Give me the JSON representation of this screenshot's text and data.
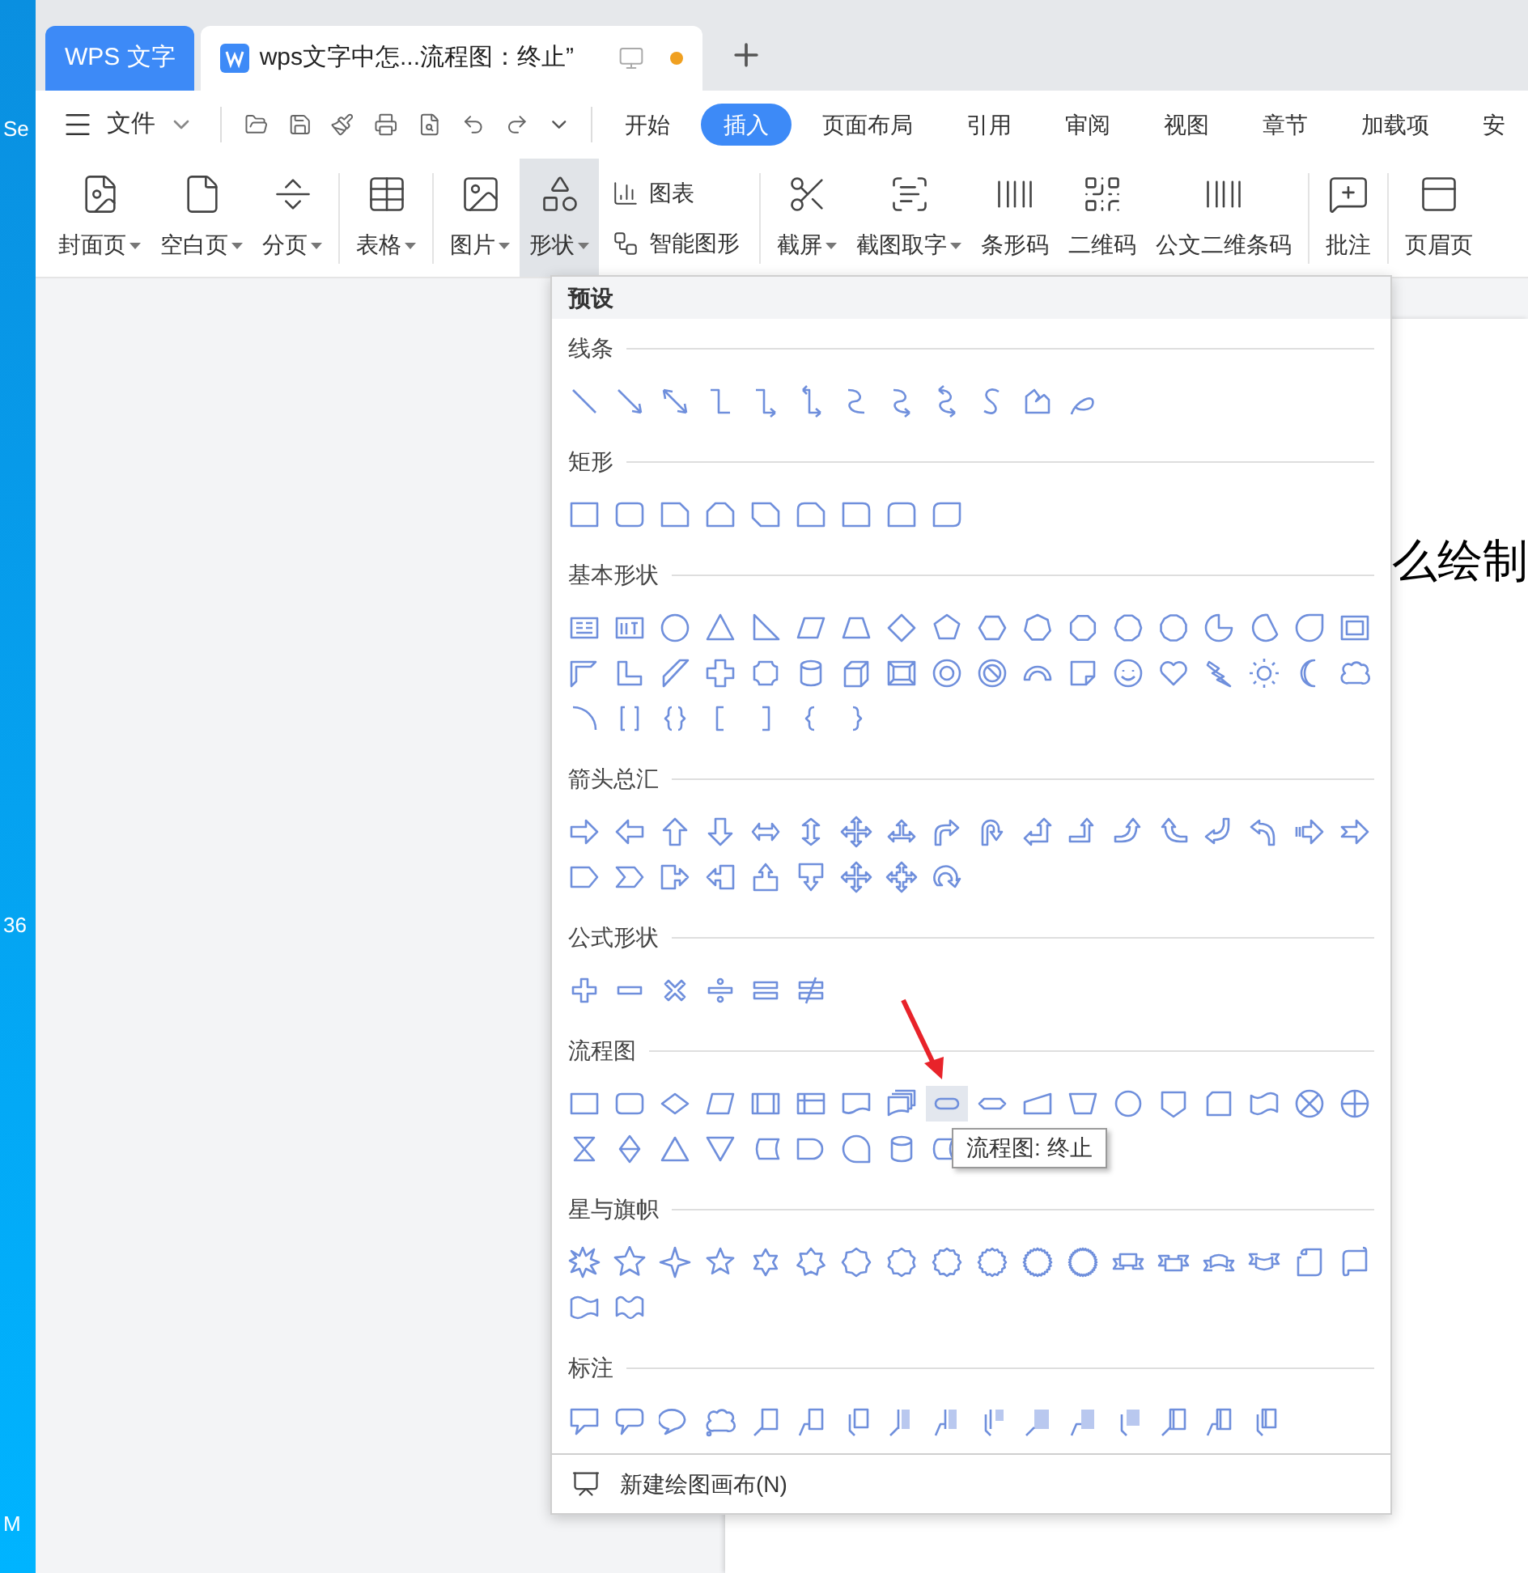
{
  "desktop": {
    "icons": [
      {
        "label": "Se"
      },
      {
        "label": "36"
      },
      {
        "label": "M"
      }
    ]
  },
  "tabs": [
    {
      "label": "WPS 文字",
      "kind": "app",
      "selected": false,
      "modified": false
    },
    {
      "label": "wps文字中怎...流程图：终止”",
      "kind": "document",
      "selected": true,
      "modified": true
    }
  ],
  "menu": {
    "label": "文件"
  },
  "ribbon_tabs": [
    {
      "label": "开始",
      "selected": false
    },
    {
      "label": "插入",
      "selected": true
    },
    {
      "label": "页面布局",
      "selected": false
    },
    {
      "label": "引用",
      "selected": false
    },
    {
      "label": "审阅",
      "selected": false
    },
    {
      "label": "视图",
      "selected": false
    },
    {
      "label": "章节",
      "selected": false
    },
    {
      "label": "加载项",
      "selected": false
    },
    {
      "label": "安",
      "selected": false
    }
  ],
  "ribbon": {
    "groups": [
      {
        "items": [
          {
            "label": "封面页",
            "kind": "large",
            "dropdown": true,
            "selected": false
          },
          {
            "label": "空白页",
            "kind": "large",
            "dropdown": true,
            "selected": false
          },
          {
            "label": "分页",
            "kind": "large",
            "dropdown": true,
            "selected": false
          }
        ]
      },
      {
        "items": [
          {
            "label": "表格",
            "kind": "large",
            "dropdown": true,
            "selected": false
          }
        ]
      },
      {
        "items": [
          {
            "label": "图片",
            "kind": "large",
            "dropdown": true,
            "selected": false
          },
          {
            "label": "形状",
            "kind": "large",
            "dropdown": true,
            "selected": true
          },
          {
            "label": "图表",
            "kind": "small",
            "dropdown": false,
            "selected": false
          },
          {
            "label": "智能图形",
            "kind": "small",
            "dropdown": false,
            "selected": false
          }
        ]
      },
      {
        "items": [
          {
            "label": "截屏",
            "kind": "large",
            "dropdown": true,
            "selected": false
          },
          {
            "label": "截图取字",
            "kind": "large",
            "dropdown": true,
            "selected": false
          },
          {
            "label": "条形码",
            "kind": "large",
            "dropdown": false,
            "selected": false
          },
          {
            "label": "二维码",
            "kind": "large",
            "dropdown": false,
            "selected": false
          },
          {
            "label": "公文二维条码",
            "kind": "large",
            "dropdown": false,
            "selected": false
          }
        ]
      },
      {
        "items": [
          {
            "label": "批注",
            "kind": "large",
            "dropdown": false,
            "selected": false
          }
        ]
      },
      {
        "items": [
          {
            "label": "页眉页",
            "kind": "large",
            "dropdown": false,
            "selected": false
          }
        ]
      }
    ]
  },
  "document": {
    "text": "么绘制"
  },
  "shapes_panel": {
    "header": "预设",
    "sections": [
      {
        "title": "线条"
      },
      {
        "title": "矩形"
      },
      {
        "title": "基本形状"
      },
      {
        "title": "箭头总汇"
      },
      {
        "title": "公式形状"
      },
      {
        "title": "流程图",
        "tooltip": "流程图: 终止"
      },
      {
        "title": "星与旗帜"
      },
      {
        "title": "标注"
      }
    ],
    "footer": "新建绘图画布(N)"
  }
}
